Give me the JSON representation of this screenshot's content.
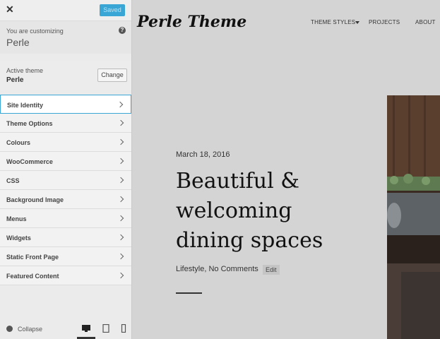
{
  "panel": {
    "close_icon": "close-icon",
    "saved_label": "Saved",
    "customizing_label": "You are customizing",
    "customizing_name": "Perle",
    "help_icon": "?",
    "active_theme_label": "Active theme",
    "active_theme_name": "Perle",
    "change_label": "Change",
    "menu": [
      {
        "label": "Site Identity",
        "active": true
      },
      {
        "label": "Theme Options"
      },
      {
        "label": "Colours"
      },
      {
        "label": "WooCommerce"
      },
      {
        "label": "CSS"
      },
      {
        "label": "Background Image"
      },
      {
        "label": "Menus"
      },
      {
        "label": "Widgets"
      },
      {
        "label": "Static Front Page"
      },
      {
        "label": "Featured Content"
      }
    ],
    "collapse_label": "Collapse",
    "devices": [
      "desktop-icon",
      "tablet-icon",
      "mobile-icon"
    ],
    "accent": "#3aa6d6"
  },
  "preview": {
    "logo": "Perle Theme",
    "nav": [
      "THEME STYLES",
      "PROJECTS",
      "ABOUT"
    ],
    "post": {
      "date": "March 18, 2016",
      "title": "Beautiful & welcoming dining spaces",
      "meta": "Lifestyle, No Comments",
      "edit_label": "Edit"
    }
  }
}
